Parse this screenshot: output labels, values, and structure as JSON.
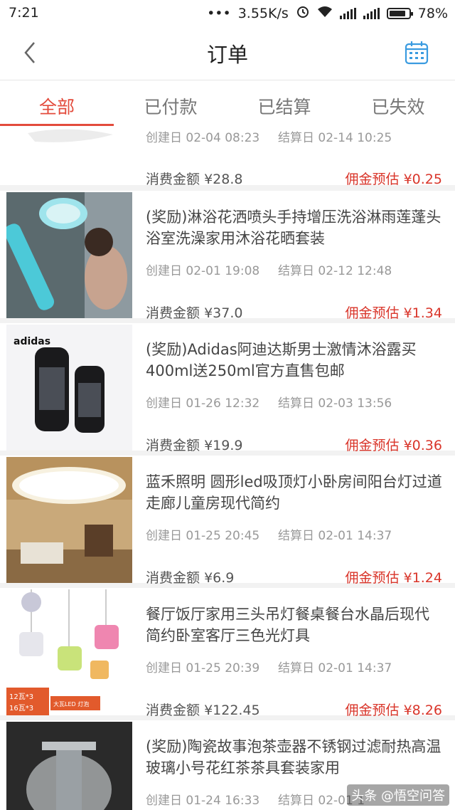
{
  "status_bar": {
    "time": "7:21",
    "dots": "•••",
    "network_speed": "3.55K/s",
    "battery": "78%"
  },
  "header": {
    "title": "订单",
    "back_icon": "chevron-left-icon",
    "calendar_icon": "calendar-icon"
  },
  "tabs": [
    {
      "label": "全部",
      "active": true
    },
    {
      "label": "已付款",
      "active": false
    },
    {
      "label": "已结算",
      "active": false
    },
    {
      "label": "已失效",
      "active": false
    }
  ],
  "orders": [
    {
      "name": "",
      "created_label": "创建日",
      "created": "02-04 08:23",
      "settled_label": "结算日",
      "settled": "02-14 10:25",
      "amount_label": "消费金额",
      "amount": "¥28.8",
      "commission_label": "佣金预估",
      "commission": "¥0.25"
    },
    {
      "name": "(奖励)淋浴花洒喷头手持增压洗浴淋雨莲蓬头浴室洗澡家用沐浴花晒套装",
      "created_label": "创建日",
      "created": "02-01 19:08",
      "settled_label": "结算日",
      "settled": "02-12 12:48",
      "amount_label": "消费金额",
      "amount": "¥37.0",
      "commission_label": "佣金预估",
      "commission": "¥1.34"
    },
    {
      "name": "(奖励)Adidas阿迪达斯男士激情沐浴露买400ml送250ml官方直售包邮",
      "created_label": "创建日",
      "created": "01-26 12:32",
      "settled_label": "结算日",
      "settled": "02-03 13:56",
      "amount_label": "消费金额",
      "amount": "¥19.9",
      "commission_label": "佣金预估",
      "commission": "¥0.36",
      "image_text": "adidas"
    },
    {
      "name": "蓝禾照明  圆形led吸顶灯小卧房间阳台灯过道走廊儿童房现代简约",
      "created_label": "创建日",
      "created": "01-25 20:45",
      "settled_label": "结算日",
      "settled": "02-01 14:37",
      "amount_label": "消费金额",
      "amount": "¥6.9",
      "commission_label": "佣金预估",
      "commission": "¥1.24"
    },
    {
      "name": "餐厅饭厅家用三头吊灯餐桌餐台水晶后现代简约卧室客厅三色光灯具",
      "created_label": "创建日",
      "created": "01-25 20:39",
      "settled_label": "结算日",
      "settled": "02-01 14:37",
      "amount_label": "消费金额",
      "amount": "¥122.45",
      "commission_label": "佣金预估",
      "commission": "¥8.26",
      "image_text_1": "12瓦*3",
      "image_text_2": "16瓦*3",
      "image_text_3": "大瓦LED 灯泡"
    },
    {
      "name": "(奖励)陶瓷故事泡茶壶器不锈钢过滤耐热高温玻璃小号花红茶茶具套装家用",
      "created_label": "创建日",
      "created": "01-24 16:33",
      "settled_label": "结算日",
      "settled": "02-01 1"
    }
  ],
  "watermark": "头条 @悟空问答",
  "colors": {
    "accent": "#e34b3c",
    "commission": "#d9352a",
    "calendar_icon": "#3a9be0"
  }
}
